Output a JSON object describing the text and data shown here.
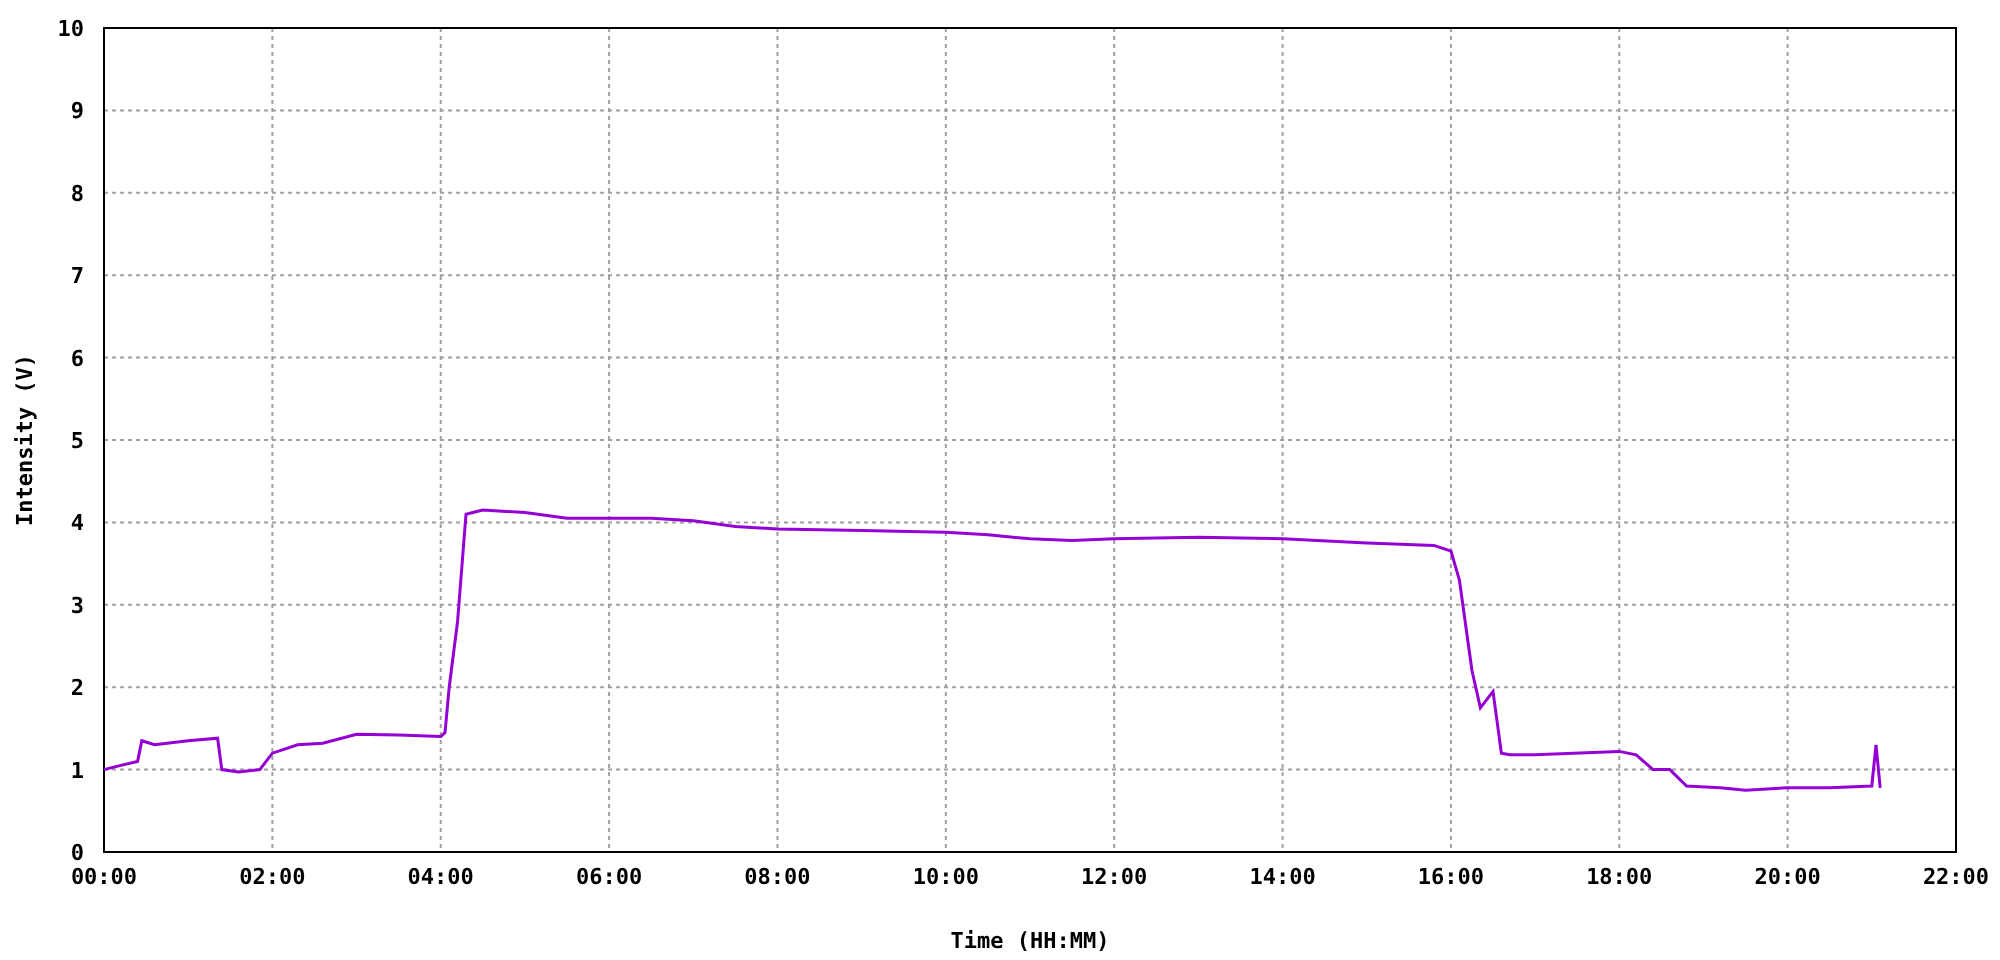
{
  "chart": {
    "chart_data": {
      "type": "line",
      "xlabel": "Time (HH:MM)",
      "ylabel": "Intensity (V)",
      "xlim": [
        0,
        22
      ],
      "ylim": [
        0,
        10
      ],
      "xticks": [
        {
          "value": 0,
          "label": "00:00"
        },
        {
          "value": 2,
          "label": "02:00"
        },
        {
          "value": 4,
          "label": "04:00"
        },
        {
          "value": 6,
          "label": "06:00"
        },
        {
          "value": 8,
          "label": "08:00"
        },
        {
          "value": 10,
          "label": "10:00"
        },
        {
          "value": 12,
          "label": "12:00"
        },
        {
          "value": 14,
          "label": "14:00"
        },
        {
          "value": 16,
          "label": "16:00"
        },
        {
          "value": 18,
          "label": "18:00"
        },
        {
          "value": 20,
          "label": "20:00"
        },
        {
          "value": 22,
          "label": "22:00"
        }
      ],
      "yticks": [
        0,
        1,
        2,
        3,
        4,
        5,
        6,
        7,
        8,
        9,
        10
      ],
      "x": [
        0,
        0.2,
        0.4,
        0.45,
        0.6,
        1.0,
        1.35,
        1.4,
        1.6,
        1.85,
        2.0,
        2.3,
        2.6,
        3.0,
        3.5,
        4.0,
        4.05,
        4.1,
        4.2,
        4.3,
        4.5,
        5.0,
        5.5,
        6.0,
        6.5,
        7.0,
        7.5,
        8.0,
        9.0,
        10.0,
        10.5,
        11.0,
        11.5,
        12.0,
        13.0,
        14.0,
        15.0,
        15.8,
        16.0,
        16.1,
        16.25,
        16.35,
        16.5,
        16.6,
        16.7,
        17.0,
        18.0,
        18.2,
        18.4,
        18.6,
        18.8,
        19.2,
        19.5,
        20.0,
        20.5,
        21.0,
        21.05,
        21.1
      ],
      "grid": true,
      "series": [
        {
          "color": "#9400d3",
          "values": [
            1.0,
            1.05,
            1.1,
            1.35,
            1.3,
            1.35,
            1.38,
            1.0,
            0.97,
            1.0,
            1.2,
            1.3,
            1.32,
            1.43,
            1.42,
            1.4,
            1.45,
            2.0,
            2.8,
            4.1,
            4.15,
            4.12,
            4.05,
            4.05,
            4.05,
            4.02,
            3.95,
            3.92,
            3.9,
            3.88,
            3.85,
            3.8,
            3.78,
            3.8,
            3.82,
            3.8,
            3.75,
            3.72,
            3.65,
            3.3,
            2.2,
            1.75,
            1.95,
            1.2,
            1.18,
            1.18,
            1.22,
            1.18,
            1.0,
            1.0,
            0.8,
            0.78,
            0.75,
            0.78,
            0.78,
            0.8,
            1.3,
            0.78
          ]
        }
      ]
    }
  }
}
